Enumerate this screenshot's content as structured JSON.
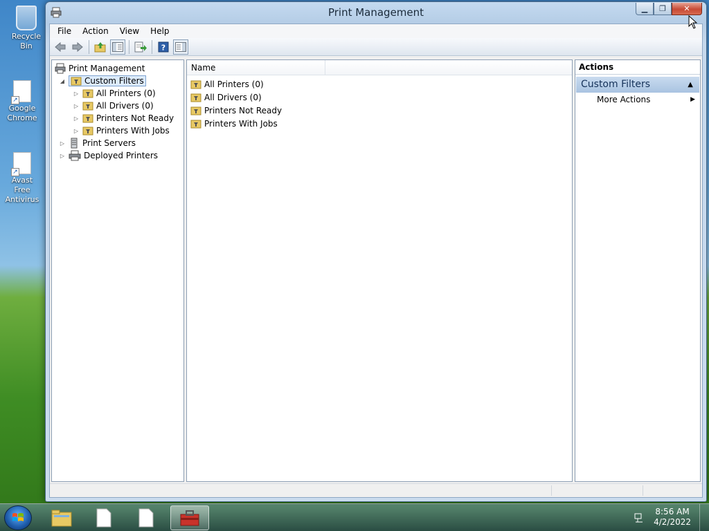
{
  "desktop": {
    "icons": [
      {
        "label": "Recycle Bin"
      },
      {
        "label": "Google Chrome"
      },
      {
        "label": "Avast Free Antivirus"
      }
    ]
  },
  "window": {
    "title": "Print Management",
    "menu": [
      "File",
      "Action",
      "View",
      "Help"
    ],
    "toolbar": [
      "back-icon",
      "forward-icon",
      "up-folder-icon",
      "show-hide-tree-icon",
      "export-list-icon",
      "help-icon",
      "show-hide-action-pane-icon"
    ],
    "tree": {
      "root": "Print Management",
      "custom_filters": "Custom Filters",
      "filters": [
        "All Printers (0)",
        "All Drivers (0)",
        "Printers Not Ready",
        "Printers With Jobs"
      ],
      "print_servers": "Print Servers",
      "deployed_printers": "Deployed Printers"
    },
    "list": {
      "column": "Name",
      "rows": [
        "All Printers (0)",
        "All Drivers (0)",
        "Printers Not Ready",
        "Printers With Jobs"
      ]
    },
    "actions": {
      "header": "Actions",
      "section": "Custom Filters",
      "items": [
        "More Actions"
      ]
    }
  },
  "taskbar": {
    "time": "8:56 AM",
    "date": "4/2/2022"
  },
  "colors": {
    "selection": "#dcebfc",
    "accent": "#15325a",
    "close_button": "#c74a35"
  }
}
